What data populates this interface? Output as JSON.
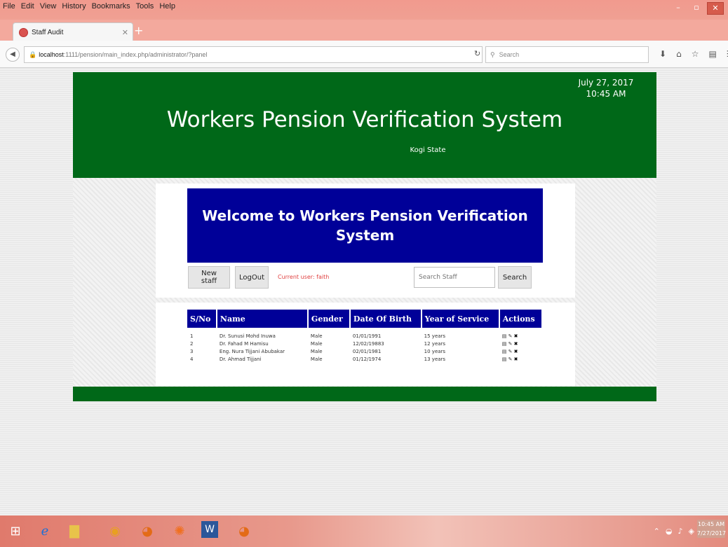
{
  "browser": {
    "menu": [
      "File",
      "Edit",
      "View",
      "History",
      "Bookmarks",
      "Tools",
      "Help"
    ],
    "tab_title": "Staff Audit",
    "url_host": "localhost",
    "url_rest": ":1111/pension/main_index.php/administrator/?panel",
    "search_placeholder": "Search",
    "window_controls": [
      "–",
      "▫",
      "✕"
    ]
  },
  "header": {
    "title": "Workers Pension Verification System",
    "state": "Kogi State",
    "date": "July 27, 2017",
    "time": "10:45 AM"
  },
  "welcome": "Welcome to Workers Pension Verification System",
  "toolbar": {
    "new_staff": "New staff",
    "logout": "LogOut",
    "current_user": "Current user: faith",
    "search_placeholder": "Search Staff",
    "search_button": "Search"
  },
  "table": {
    "columns": [
      "S/No",
      "Name",
      "Gender",
      "Date Of Birth",
      "Year of Service",
      "Actions"
    ],
    "rows": [
      {
        "sn": "1",
        "name": "Dr. Sunusi Mohd Inuwa",
        "gender": "Male",
        "dob": "01/01/1991",
        "service": "15 years"
      },
      {
        "sn": "2",
        "name": "Dr. Fahad M Hamisu",
        "gender": "Male",
        "dob": "12/02/19883",
        "service": "12 years"
      },
      {
        "sn": "3",
        "name": "Eng. Nura Tijjani Abubakar",
        "gender": "Male",
        "dob": "02/01/1981",
        "service": "10 years"
      },
      {
        "sn": "4",
        "name": "Dr. Ahmad Tijjani",
        "gender": "Male",
        "dob": "01/12/1974",
        "service": "13 years"
      }
    ],
    "action_icons": [
      "view-icon",
      "edit-icon",
      "delete-icon"
    ]
  },
  "taskbar": {
    "clock_time": "10:45 AM",
    "clock_date": "7/27/2017"
  },
  "colors": {
    "header_green": "#006818",
    "welcome_blue": "#000098",
    "current_user_red": "#e04040"
  }
}
